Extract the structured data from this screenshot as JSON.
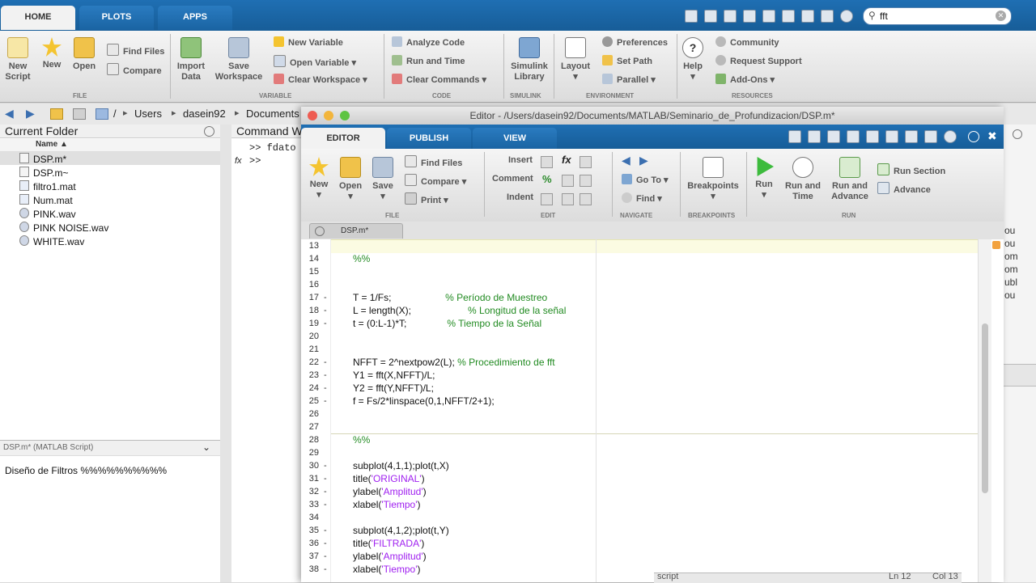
{
  "main_tabs": [
    "HOME",
    "PLOTS",
    "APPS"
  ],
  "search": {
    "value": "fft"
  },
  "home_ribbon": {
    "new_script": "New\nScript",
    "new": "New",
    "open": "Open",
    "find_files": "Find Files",
    "compare": "Compare",
    "import_data": "Import\nData",
    "save_workspace": "Save\nWorkspace",
    "new_variable": "New Variable",
    "open_variable": "Open Variable",
    "clear_workspace": "Clear Workspace",
    "analyze_code": "Analyze Code",
    "run_and_time": "Run and Time",
    "clear_commands": "Clear Commands",
    "simulink_library": "Simulink\nLibrary",
    "layout": "Layout",
    "preferences": "Preferences",
    "set_path": "Set Path",
    "parallel": "Parallel",
    "help": "Help",
    "community": "Community",
    "request_support": "Request Support",
    "add_ons": "Add-Ons",
    "groups": [
      "FILE",
      "VARIABLE",
      "CODE",
      "SIMULINK",
      "ENVIRONMENT",
      "RESOURCES"
    ]
  },
  "address": [
    "/",
    "Users",
    "dasein92",
    "Documents"
  ],
  "current_folder": {
    "title": "Current Folder",
    "column": "Name ▲",
    "files": [
      "DSP.m*",
      "DSP.m~",
      "filtro1.mat",
      "Num.mat",
      "PINK.wav",
      "PINK NOISE.wav",
      "WHITE.wav"
    ],
    "details_title": "DSP.m* (MATLAB Script)",
    "details_text": "Diseño de Filtros %%%%%%%%%%"
  },
  "command_window": {
    "title": "Command W",
    "line1": ">> fdato",
    "fx": "fx",
    "prompt": ">>"
  },
  "editor": {
    "title": "Editor - /Users/dasein92/Documents/MATLAB/Seminario_de_Profundizacion/DSP.m*",
    "tabs": [
      "EDITOR",
      "PUBLISH",
      "VIEW"
    ],
    "ribbon": {
      "new": "New",
      "open": "Open",
      "save": "Save",
      "find_files": "Find Files",
      "compare": "Compare",
      "print": "Print",
      "insert": "Insert",
      "comment": "Comment",
      "indent": "Indent",
      "go_to": "Go To",
      "find": "Find",
      "breakpoints": "Breakpoints",
      "run": "Run",
      "run_and_time": "Run and\nTime",
      "run_and_advance": "Run and\nAdvance",
      "run_section": "Run Section",
      "advance": "Advance",
      "groups": [
        "FILE",
        "EDIT",
        "NAVIGATE",
        "BREAKPOINTS",
        "RUN"
      ]
    },
    "doc_tab": "DSP.m*",
    "lines": [
      {
        "n": "13",
        "dash": "",
        "parts": [
          {
            "t": "",
            "c": "code"
          }
        ]
      },
      {
        "n": "14",
        "dash": "",
        "parts": [
          {
            "t": "%%",
            "c": "comment"
          }
        ]
      },
      {
        "n": "15",
        "dash": "",
        "parts": [
          {
            "t": "",
            "c": "code"
          }
        ]
      },
      {
        "n": "16",
        "dash": "",
        "parts": [
          {
            "t": "",
            "c": "code"
          }
        ]
      },
      {
        "n": "17",
        "dash": "-",
        "parts": [
          {
            "t": "T = 1/Fs;                    ",
            "c": "code"
          },
          {
            "t": "% Período de Muestreo",
            "c": "comment"
          }
        ]
      },
      {
        "n": "18",
        "dash": "-",
        "parts": [
          {
            "t": "L = length(X);                     ",
            "c": "code"
          },
          {
            "t": "% Longitud de la señal",
            "c": "comment"
          }
        ]
      },
      {
        "n": "19",
        "dash": "-",
        "parts": [
          {
            "t": "t = (0:L-1)*T;               ",
            "c": "code"
          },
          {
            "t": "% Tiempo de la Señal",
            "c": "comment"
          }
        ]
      },
      {
        "n": "20",
        "dash": "",
        "parts": [
          {
            "t": "",
            "c": "code"
          }
        ]
      },
      {
        "n": "21",
        "dash": "",
        "parts": [
          {
            "t": "",
            "c": "code"
          }
        ]
      },
      {
        "n": "22",
        "dash": "-",
        "parts": [
          {
            "t": "NFFT = 2^nextpow2(L); ",
            "c": "code"
          },
          {
            "t": "% Procedimiento de fft",
            "c": "comment"
          }
        ]
      },
      {
        "n": "23",
        "dash": "-",
        "parts": [
          {
            "t": "Y1 = fft(X,NFFT)/L;",
            "c": "code"
          }
        ]
      },
      {
        "n": "24",
        "dash": "-",
        "parts": [
          {
            "t": "Y2 = fft(Y,NFFT)/L;",
            "c": "code"
          }
        ]
      },
      {
        "n": "25",
        "dash": "-",
        "parts": [
          {
            "t": "f = Fs/2*linspace(0,1,NFFT/2+1);",
            "c": "code"
          }
        ]
      },
      {
        "n": "26",
        "dash": "",
        "parts": [
          {
            "t": "",
            "c": "code"
          }
        ]
      },
      {
        "n": "27",
        "dash": "",
        "parts": [
          {
            "t": "",
            "c": "code"
          }
        ]
      },
      {
        "n": "28",
        "dash": "",
        "parts": [
          {
            "t": "%%",
            "c": "comment"
          }
        ]
      },
      {
        "n": "29",
        "dash": "",
        "parts": [
          {
            "t": "",
            "c": "code"
          }
        ]
      },
      {
        "n": "30",
        "dash": "-",
        "parts": [
          {
            "t": "subplot(4,1,1);plot(t,X)",
            "c": "code"
          }
        ]
      },
      {
        "n": "31",
        "dash": "-",
        "parts": [
          {
            "t": "title(",
            "c": "code"
          },
          {
            "t": "'ORIGINAL'",
            "c": "string"
          },
          {
            "t": ")",
            "c": "code"
          }
        ]
      },
      {
        "n": "32",
        "dash": "-",
        "parts": [
          {
            "t": "ylabel(",
            "c": "code"
          },
          {
            "t": "'Amplitud'",
            "c": "string"
          },
          {
            "t": ")",
            "c": "code"
          }
        ]
      },
      {
        "n": "33",
        "dash": "-",
        "parts": [
          {
            "t": "xlabel(",
            "c": "code"
          },
          {
            "t": "'Tiempo'",
            "c": "string"
          },
          {
            "t": ")",
            "c": "code"
          }
        ]
      },
      {
        "n": "34",
        "dash": "",
        "parts": [
          {
            "t": "",
            "c": "code"
          }
        ]
      },
      {
        "n": "35",
        "dash": "-",
        "parts": [
          {
            "t": "subplot(4,1,2);plot(t,Y)",
            "c": "code"
          }
        ]
      },
      {
        "n": "36",
        "dash": "-",
        "parts": [
          {
            "t": "title(",
            "c": "code"
          },
          {
            "t": "'FILTRADA'",
            "c": "string"
          },
          {
            "t": ")",
            "c": "code"
          }
        ]
      },
      {
        "n": "37",
        "dash": "-",
        "parts": [
          {
            "t": "ylabel(",
            "c": "code"
          },
          {
            "t": "'Amplitud'",
            "c": "string"
          },
          {
            "t": ")",
            "c": "code"
          }
        ]
      },
      {
        "n": "38",
        "dash": "-",
        "parts": [
          {
            "t": "xlabel(",
            "c": "code"
          },
          {
            "t": "'Tiempo'",
            "c": "string"
          },
          {
            "t": ")",
            "c": "code"
          }
        ]
      }
    ],
    "status": {
      "script": "script",
      "ln": "Ln 12",
      "col": "Col 13"
    }
  },
  "right_strip": [
    "ou",
    "ou",
    "om",
    "om",
    "ubl",
    "ou"
  ],
  "colors": {
    "toolstrip_blue": "#1f6fb3",
    "comment": "#228b22",
    "string": "#a020f0",
    "cell_highlight": "#fbfbe2"
  }
}
